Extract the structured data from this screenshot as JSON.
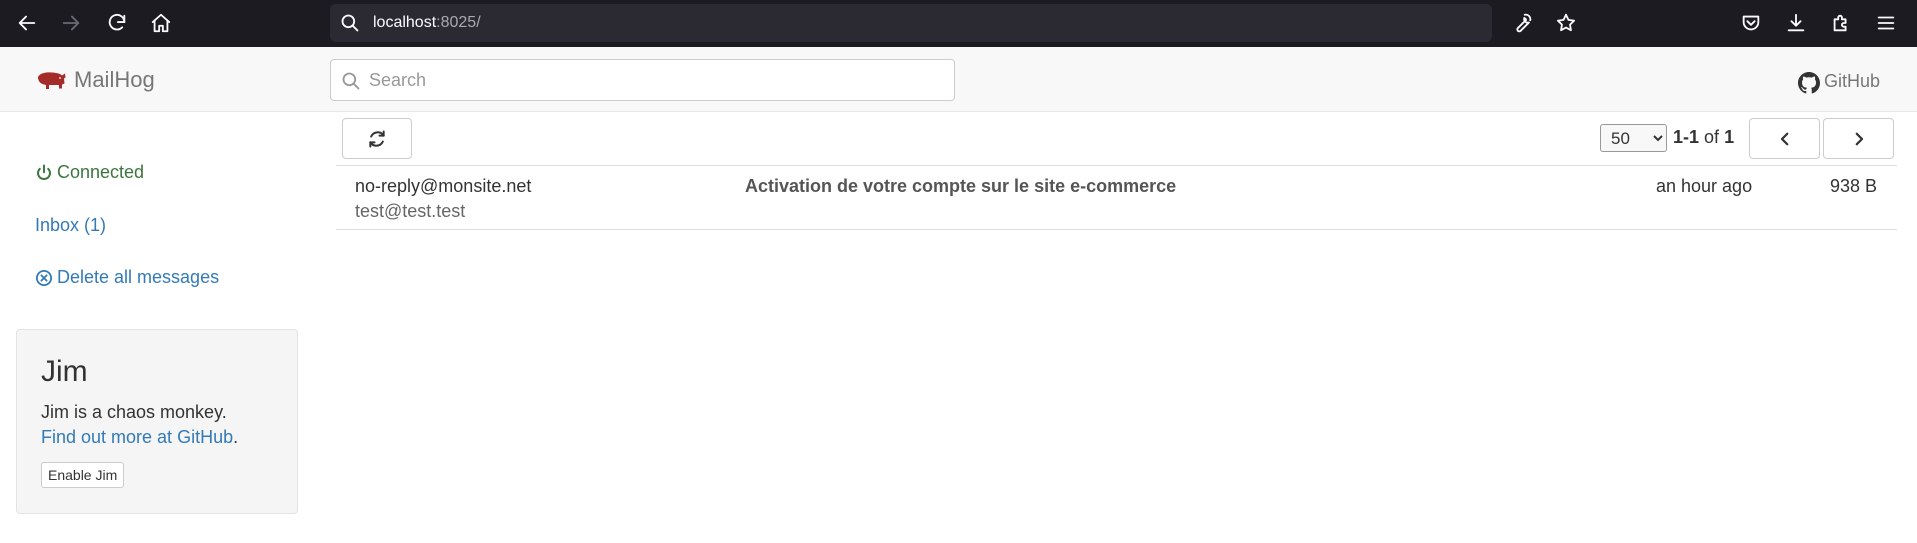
{
  "browser": {
    "url_host": "localhost",
    "url_rest": ":8025/"
  },
  "app": {
    "brand": "MailHog",
    "search_placeholder": "Search",
    "github_label": "GitHub"
  },
  "sidebar": {
    "connected_label": "Connected",
    "inbox_label": "Inbox (1)",
    "delete_all_label": "Delete all messages"
  },
  "jim": {
    "title": "Jim",
    "description": "Jim is a chaos monkey.",
    "link_text": "Find out more at GitHub",
    "link_suffix": ".",
    "button_label": "Enable Jim"
  },
  "toolbar": {
    "per_page_selected": "50",
    "range": "1-1",
    "of_label": "of",
    "total": "1"
  },
  "messages": [
    {
      "from": "no-reply@monsite.net",
      "to": "test@test.test",
      "subject": "Activation de votre compte sur le site e-commerce",
      "time": "an hour ago",
      "size": "938 B"
    }
  ],
  "colors": {
    "browser_bar": "#1c1b22",
    "link_blue": "#337ab7",
    "connected_green": "#3c763d",
    "brand_red": "#a52a2a"
  }
}
